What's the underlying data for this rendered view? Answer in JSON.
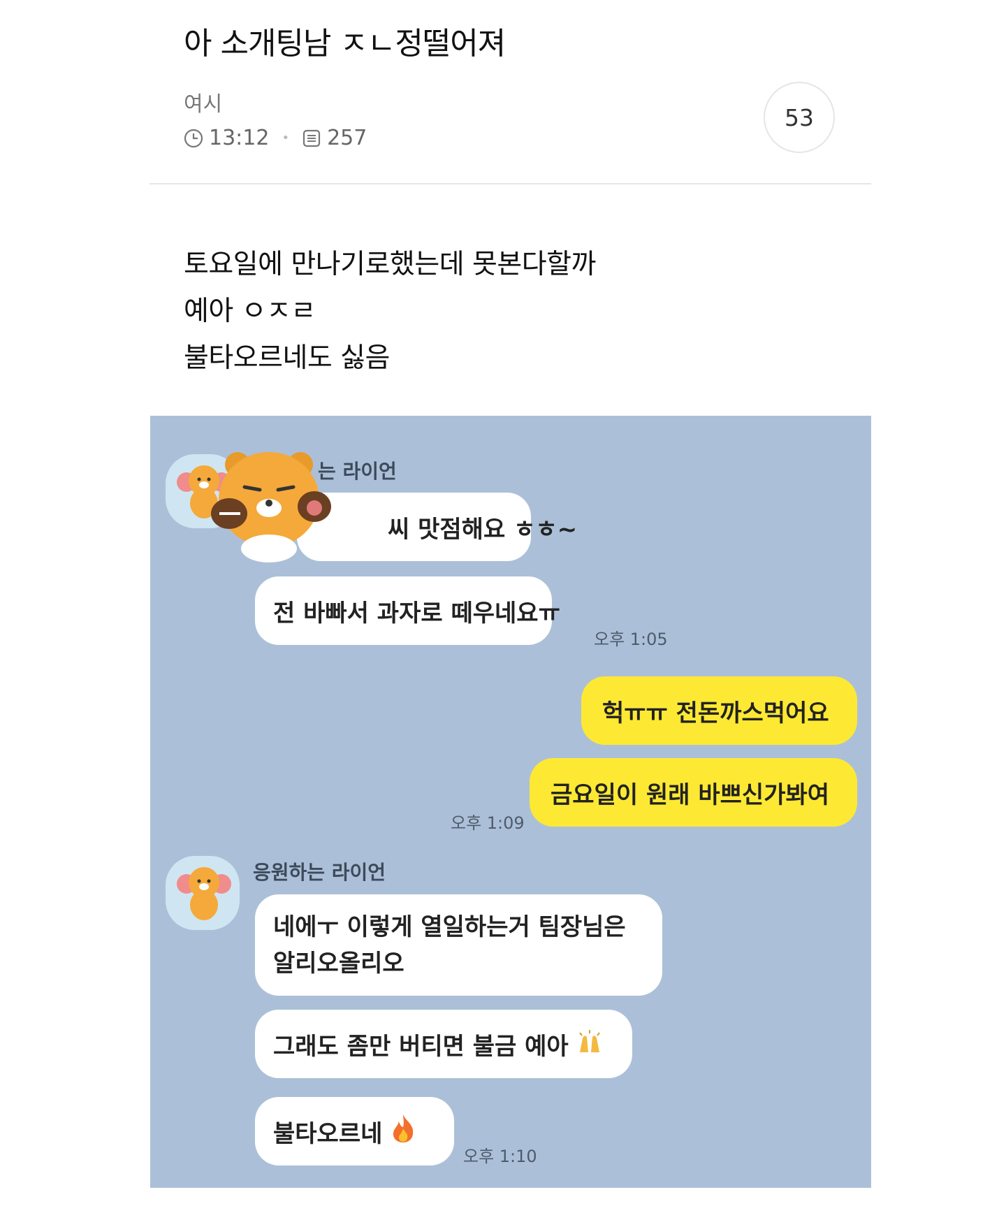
{
  "post": {
    "title": "아 소개팅남 ㅈㄴ정떨어져",
    "author": "여시",
    "time": "13:12",
    "views": "257",
    "comment_count": "53",
    "body_lines": [
      "토요일에 만나기로했는데 못본다할까",
      "예아 ㅇㅈㄹ",
      "불타오르네도 싫음"
    ]
  },
  "chat": {
    "background_color": "#abc0d8",
    "bubble_yellow": "#fde933",
    "sender_name_partial": "는 라이언",
    "sender_name": "응원하는 라이언",
    "messages": {
      "m1": "씨 맛점해요 ㅎㅎ~",
      "m2": "전 바빠서 과자로 떼우네요ㅠ",
      "m2_time": "오후 1:05",
      "m3": "헉ㅠㅠ 전돈까스먹어요",
      "m4": "금요일이 원래 바쁘신가봐여",
      "m4_time": "오후 1:09",
      "m5": "네에ㅜ 이렇게 열일하는거 팀장님은 알리오올리오",
      "m6": "그래도 좀만 버티면 불금 예아",
      "m7": "불타오르네",
      "m7_time": "오후 1:10"
    },
    "icons": [
      "lion-character-avatar-icon",
      "lion-sticker-icon",
      "raising-hands-emoji-icon",
      "fire-emoji-icon"
    ]
  }
}
